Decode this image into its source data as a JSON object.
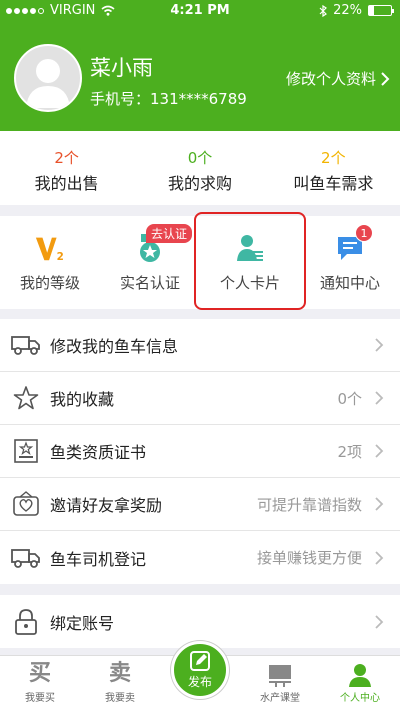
{
  "status_bar": {
    "carrier": "VIRGIN",
    "time": "4:21 PM",
    "battery": "22%",
    "battery_level": 0.22
  },
  "profile": {
    "name": "菜小雨",
    "phone": "手机号：131****6789",
    "edit_label": "修改个人资料"
  },
  "stats": [
    {
      "count": "2个",
      "label": "我的出售",
      "color": "#e8512a"
    },
    {
      "count": "0个",
      "label": "我的求购",
      "color": "#4caf1f"
    },
    {
      "count": "2个",
      "label": "叫鱼车需求",
      "color": "#f2b400"
    }
  ],
  "quick_actions": [
    {
      "label": "我的等级",
      "icon": "level-v2-icon"
    },
    {
      "label": "实名认证",
      "icon": "certification-medal-icon",
      "tag": "去认证"
    },
    {
      "label": "个人卡片",
      "icon": "personal-card-icon"
    },
    {
      "label": "通知中心",
      "icon": "notification-icon",
      "badge": "1"
    }
  ],
  "menu_group_1": [
    {
      "title": "修改我的鱼车信息",
      "value": "",
      "icon": "truck-icon"
    },
    {
      "title": "我的收藏",
      "value": "0个",
      "icon": "star-icon"
    },
    {
      "title": "鱼类资质证书",
      "value": "2项",
      "icon": "certificate-icon"
    },
    {
      "title": "邀请好友拿奖励",
      "value": "可提升靠谱指数",
      "icon": "gift-icon"
    },
    {
      "title": "鱼车司机登记",
      "value": "接单赚钱更方便",
      "icon": "truck-icon"
    }
  ],
  "menu_group_2": [
    {
      "title": "绑定账号",
      "value": "",
      "icon": "lock-icon"
    }
  ],
  "tabbar": {
    "buy": {
      "big": "买",
      "label": "我要买"
    },
    "sell": {
      "big": "卖",
      "label": "我要卖"
    },
    "publish": "发布",
    "class": {
      "label": "水产课堂"
    },
    "me": {
      "label": "个人中心"
    }
  },
  "colors": {
    "brand_green": "#4caf1f",
    "badge_red": "#e8454e",
    "teal": "#3fb7a3",
    "blue": "#3a8ee6",
    "orange": "#f29b10"
  }
}
